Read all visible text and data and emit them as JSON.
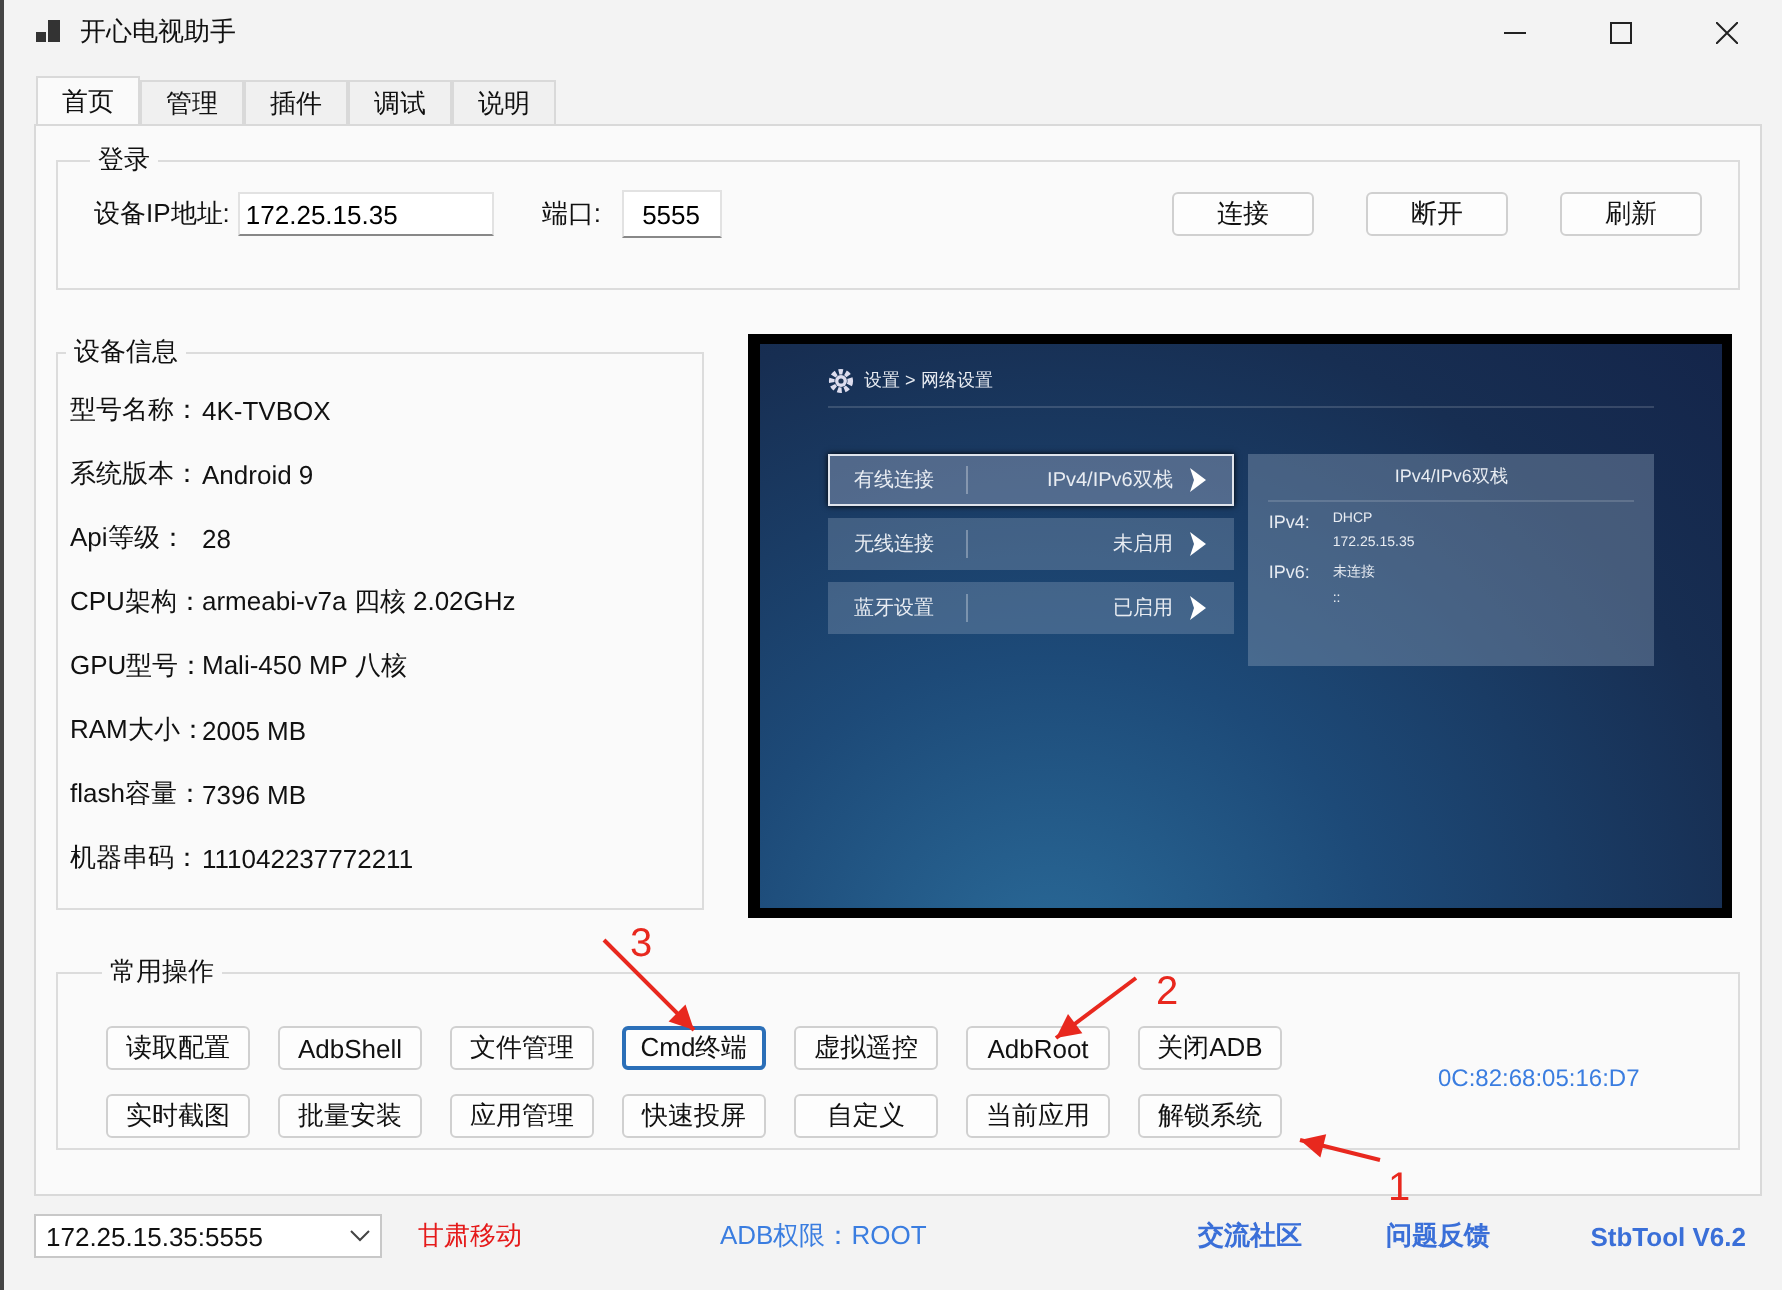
{
  "window": {
    "title": "开心电视助手"
  },
  "tabs": [
    {
      "label": "首页",
      "selected": true
    },
    {
      "label": "管理",
      "selected": false
    },
    {
      "label": "插件",
      "selected": false
    },
    {
      "label": "调试",
      "selected": false
    },
    {
      "label": "说明",
      "selected": false
    }
  ],
  "login": {
    "title": "登录",
    "ip_label": "设备IP地址:",
    "ip_value": "172.25.15.35",
    "port_label": "端口:",
    "port_value": "5555",
    "buttons": [
      "连接",
      "断开",
      "刷新"
    ]
  },
  "device_info": {
    "title": "设备信息",
    "rows": [
      {
        "label": "型号名称：",
        "value": "4K-TVBOX"
      },
      {
        "label": "系统版本：",
        "value": "Android 9"
      },
      {
        "label": "Api等级：",
        "value": "28"
      },
      {
        "label": "CPU架构：",
        "value": "armeabi-v7a 四核 2.02GHz"
      },
      {
        "label": "GPU型号：",
        "value": "Mali-450 MP 八核"
      },
      {
        "label": "RAM大小：",
        "value": "2005 MB"
      },
      {
        "label": "flash容量：",
        "value": "7396 MB"
      },
      {
        "label": "机器串码：",
        "value": "111042237772211"
      }
    ]
  },
  "tv_screen": {
    "breadcrumb": "设置 > 网络设置",
    "menu": [
      {
        "label": "有线连接",
        "value": "IPv4/IPv6双栈",
        "selected": true
      },
      {
        "label": "无线连接",
        "value": "未启用",
        "selected": false
      },
      {
        "label": "蓝牙设置",
        "value": "已启用",
        "selected": false
      }
    ],
    "detail": {
      "title": "IPv4/IPv6双栈",
      "rows": [
        {
          "label": "IPv4:",
          "lines": [
            "DHCP",
            "172.25.15.35"
          ]
        },
        {
          "label": "IPv6:",
          "lines": [
            "未连接",
            "::"
          ]
        }
      ]
    }
  },
  "operations": {
    "title": "常用操作",
    "rows": [
      [
        {
          "label": "读取配置",
          "focused": false
        },
        {
          "label": "AdbShell",
          "focused": false
        },
        {
          "label": "文件管理",
          "focused": false
        },
        {
          "label": "Cmd终端",
          "focused": true
        },
        {
          "label": "虚拟遥控",
          "focused": false
        },
        {
          "label": "AdbRoot",
          "focused": false
        },
        {
          "label": "关闭ADB",
          "focused": false
        }
      ],
      [
        {
          "label": "实时截图",
          "focused": false
        },
        {
          "label": "批量安装",
          "focused": false
        },
        {
          "label": "应用管理",
          "focused": false
        },
        {
          "label": "快速投屏",
          "focused": false
        },
        {
          "label": "自定义",
          "focused": false
        },
        {
          "label": "当前应用",
          "focused": false
        },
        {
          "label": "解锁系统",
          "focused": false
        }
      ]
    ],
    "mac": "0C:82:68:05:16:D7"
  },
  "status_bar": {
    "address": "172.25.15.35:5555",
    "carrier": "甘肃移动",
    "permission": "ADB权限：ROOT",
    "links": [
      "交流社区",
      "问题反馈"
    ],
    "version": "StbTool V6.2"
  },
  "annotations": [
    {
      "number": "3"
    },
    {
      "number": "2"
    },
    {
      "number": "1"
    }
  ]
}
